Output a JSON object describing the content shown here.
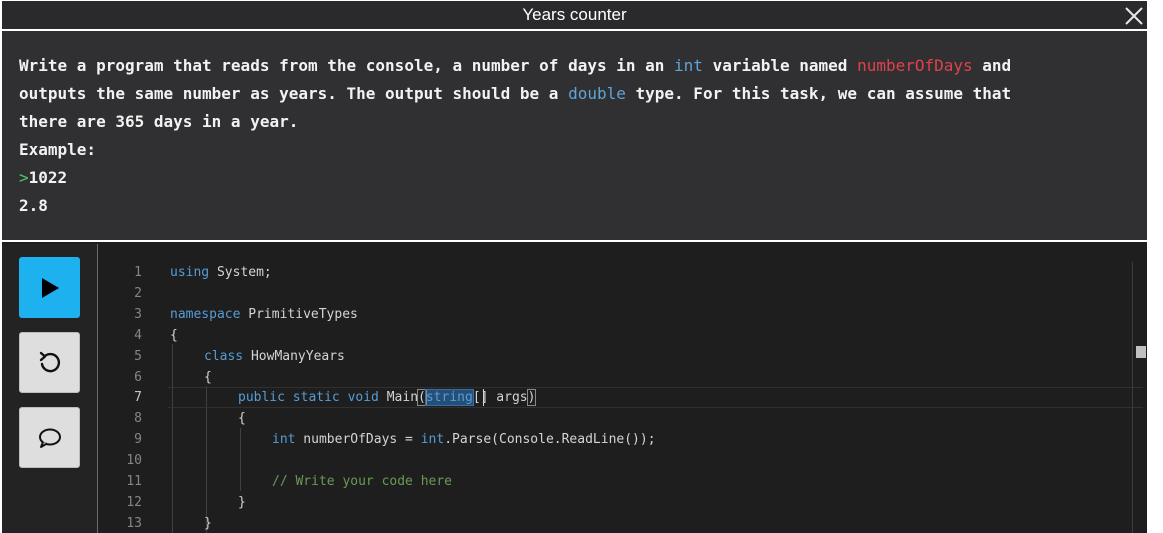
{
  "window": {
    "title": "Years counter"
  },
  "task": {
    "line1_a": "Write a program that reads from the console, a number of days in an ",
    "line1_kw": "int",
    "line1_b": " variable named ",
    "line1_var": "numberOfDays",
    "line1_c": " and",
    "line2_a": "outputs the same number as years. The output should be a ",
    "line2_kw": "double",
    "line2_b": " type. For this task, we can assume that",
    "line3": "there are 365 days in a year.",
    "example_label": "Example:",
    "prompt_symbol": ">",
    "example_input": "1022",
    "example_output": "2.8"
  },
  "toolbar": {
    "run_icon": "play-icon",
    "reset_icon": "reset-icon",
    "chat_icon": "chat-bubble-icon"
  },
  "editor": {
    "line_numbers": [
      "1",
      "2",
      "3",
      "4",
      "5",
      "6",
      "7",
      "8",
      "9",
      "10",
      "11",
      "12",
      "13"
    ],
    "active_line": "7",
    "code": {
      "l1_kw": "using",
      "l1_rest": " System;",
      "l3_kw": "namespace",
      "l3_rest": " PrimitiveTypes",
      "l4": "{",
      "l5_kw": "class",
      "l5_rest": " HowManyYears",
      "l6": "{",
      "l7_kw": "public static void",
      "l7_name": " Main",
      "l7_open": "(",
      "l7_type": "string",
      "l7_rest": "[] args",
      "l7_close": ")",
      "l8": "{",
      "l9_kw": "int",
      "l9_mid": " numberOfDays = ",
      "l9_kw2": "int",
      "l9_rest": ".Parse(Console.ReadLine());",
      "l11": "// Write your code here",
      "l12": "}",
      "l13": "}"
    }
  },
  "colors": {
    "run_button": "#1db1f0",
    "keyword": "#569cd6",
    "variable_highlight": "#e0424c",
    "comment": "#6a9955",
    "prompt": "#4ec96a"
  }
}
